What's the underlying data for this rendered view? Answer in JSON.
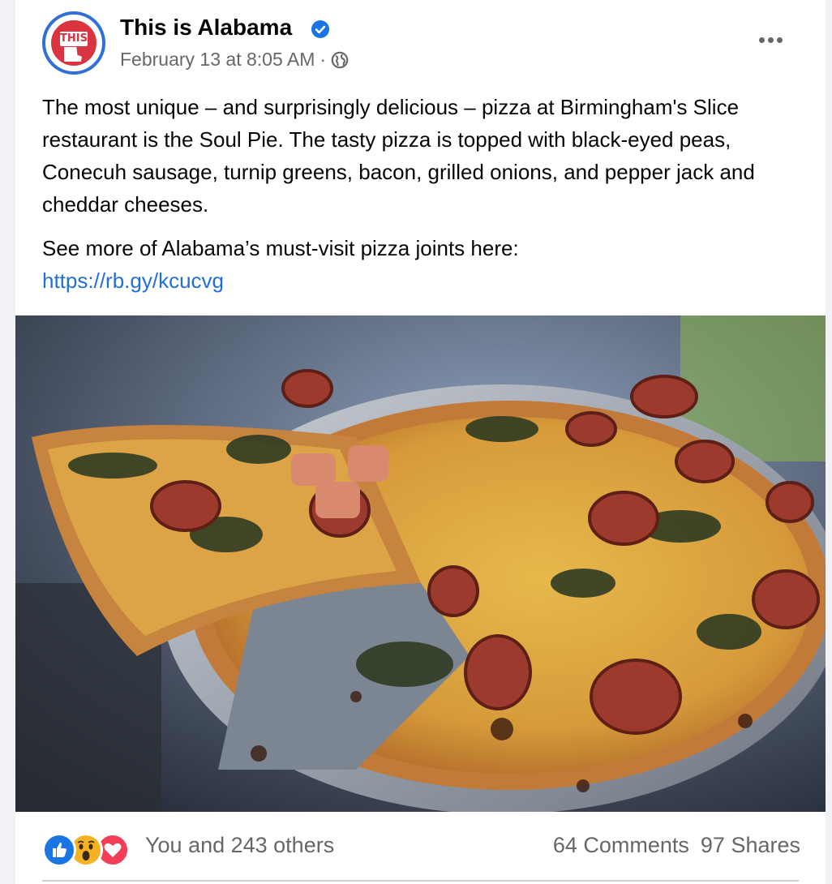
{
  "post": {
    "page_name": "This is Alabama",
    "avatar_label": "THIS.",
    "timestamp": "February 13 at 8:05 AM",
    "separator": "·",
    "body_paragraph": "The most unique – and surprisingly delicious – pizza at Birmingham's Slice restaurant is the Soul Pie. The tasty pizza is topped with black-eyed peas, Conecuh sausage, turnip greens, bacon, grilled onions, and pepper jack and cheddar cheeses.",
    "see_more_text": "See more of Alabama’s must-visit pizza joints here:",
    "link_text": "https://rb.gy/kcucvg"
  },
  "footer": {
    "reactions_text": "You and 243 others",
    "comments": "64 Comments",
    "shares": "97 Shares"
  },
  "icons": {
    "verified": "verified-badge-icon",
    "privacy": "globe-icon",
    "more": "more-options-icon",
    "reactions": [
      "like-reaction-icon",
      "wow-reaction-icon",
      "love-reaction-icon"
    ]
  },
  "colors": {
    "link": "#216fdb",
    "verified": "#1b74e4",
    "like": "#1b74e4",
    "love": "#f33e58",
    "wow": "#f7b125",
    "secondary_text": "#65676b",
    "brand_red": "#d9343f"
  }
}
